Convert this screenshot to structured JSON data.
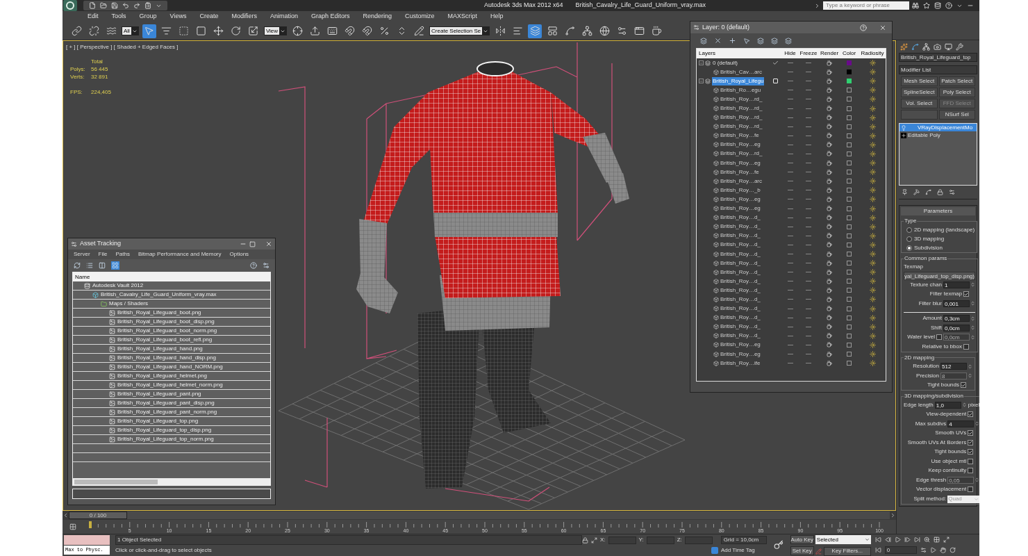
{
  "title_bar": {
    "app": "Autodesk 3ds Max  2012 x64",
    "file": "British_Cavalry_Life_Guard_Uniform_vray.max",
    "search": {
      "placeholder": "Type a keyword or phrase"
    }
  },
  "menu": [
    "Edit",
    "Tools",
    "Group",
    "Views",
    "Create",
    "Modifiers",
    "Animation",
    "Graph Editors",
    "Rendering",
    "Customize",
    "MAXScript",
    "Help"
  ],
  "toolbar": [
    {
      "kind": "link",
      "selected": false
    },
    {
      "kind": "unlink",
      "selected": false
    },
    {
      "kind": "bind",
      "selected": false
    },
    {
      "kind": "dropdown",
      "value": "All"
    },
    {
      "kind": "select",
      "selected": true
    },
    {
      "kind": "select-name",
      "selected": false
    },
    {
      "kind": "region",
      "selected": false
    },
    {
      "kind": "crossing",
      "selected": false
    },
    {
      "kind": "move",
      "selected": false
    },
    {
      "kind": "rotate",
      "selected": false
    },
    {
      "kind": "scale",
      "selected": false
    },
    {
      "kind": "dropdown",
      "value": "View"
    },
    {
      "kind": "pivot",
      "selected": false
    },
    {
      "kind": "manipulate",
      "selected": false
    },
    {
      "kind": "shortcut",
      "selected": false
    },
    {
      "kind": "snap",
      "selected": false
    },
    {
      "kind": "angle-snap",
      "selected": false
    },
    {
      "kind": "percent-snap",
      "selected": false
    },
    {
      "kind": "spinner-snap",
      "selected": false
    },
    {
      "kind": "named-sel",
      "selected": false
    },
    {
      "kind": "dropdown",
      "value": "Create Selection Se"
    },
    {
      "kind": "mirror",
      "selected": false
    },
    {
      "kind": "align",
      "selected": false
    },
    {
      "kind": "layers",
      "selected": true
    },
    {
      "kind": "ribbon",
      "selected": false
    },
    {
      "kind": "curve",
      "selected": false
    },
    {
      "kind": "schematic",
      "selected": false
    },
    {
      "kind": "material",
      "selected": false
    },
    {
      "kind": "render-setup",
      "selected": false
    },
    {
      "kind": "frame-window",
      "selected": false
    },
    {
      "kind": "render",
      "selected": false
    }
  ],
  "viewport": {
    "label": "[ + ] [ Perspective ] [ Shaded + Edged Faces ]",
    "stats_header": "Total",
    "stats": [
      {
        "label": "Polys:",
        "value": "56 445"
      },
      {
        "label": "Verts:",
        "value": "32 891"
      }
    ],
    "performance": [
      {
        "label": "FPS:",
        "value": "224,405"
      }
    ]
  },
  "asset_tracking": {
    "title": "Asset Tracking",
    "menu": [
      "Server",
      "File",
      "Paths",
      "Bitmap Performance and Memory",
      "Options"
    ],
    "column": "Name",
    "tree": [
      {
        "name": "Autodesk Vault 2012",
        "kind": "vault",
        "children": [
          {
            "name": "British_Cavalry_Life_Guard_Uniform_vray.max",
            "kind": "scene",
            "children": [
              {
                "name": "Maps / Shaders",
                "kind": "folder",
                "children": [
                  {
                    "name": "British_Royal_Lifeguard_boot.png",
                    "kind": "map"
                  },
                  {
                    "name": "British_Royal_Lifeguard_boot_disp.png",
                    "kind": "map"
                  },
                  {
                    "name": "British_Royal_Lifeguard_boot_norm.png",
                    "kind": "map"
                  },
                  {
                    "name": "British_Royal_Lifeguard_boot_refl.png",
                    "kind": "map"
                  },
                  {
                    "name": "British_Royal_Lifeguard_hand.png",
                    "kind": "map"
                  },
                  {
                    "name": "British_Royal_Lifeguard_hand_disp.png",
                    "kind": "map"
                  },
                  {
                    "name": "British_Royal_Lifeguard_hand_NORM.png",
                    "kind": "map"
                  },
                  {
                    "name": "British_Royal_Lifeguard_helmet.png",
                    "kind": "map"
                  },
                  {
                    "name": "British_Royal_Lifeguard_helmet_norm.png",
                    "kind": "map"
                  },
                  {
                    "name": "British_Royal_Lifeguard_pant.png",
                    "kind": "map"
                  },
                  {
                    "name": "British_Royal_Lifeguard_pant_disp.png",
                    "kind": "map"
                  },
                  {
                    "name": "British_Royal_Lifeguard_pant_norm.png",
                    "kind": "map"
                  },
                  {
                    "name": "British_Royal_Lifeguard_top.png",
                    "kind": "map"
                  },
                  {
                    "name": "British_Royal_Lifeguard_top_disp.png",
                    "kind": "map"
                  },
                  {
                    "name": "British_Royal_Lifeguard_top_norm.png",
                    "kind": "map"
                  }
                ]
              }
            ]
          }
        ]
      }
    ]
  },
  "layer_manager": {
    "title": "Layer: 0 (default)",
    "columns": [
      "Layers",
      "Hide",
      "Freeze",
      "Render",
      "Color",
      "Radiosity"
    ],
    "layers": [
      {
        "name": "0 (default)",
        "current": true,
        "selected": false,
        "expanded": true,
        "color": "#6a0a8c",
        "objects": [
          {
            "name": "British_Cav…arc",
            "color": "#000000"
          }
        ]
      },
      {
        "name": "British_Royal_Lifegu",
        "current": false,
        "selected": true,
        "expanded": true,
        "color": "#30d070",
        "objects": [
          {
            "name": "British_Ro…egu"
          },
          {
            "name": "British_Roy…rd_"
          },
          {
            "name": "British_Roy…rd_"
          },
          {
            "name": "British_Roy…rd_"
          },
          {
            "name": "British_Roy…rd_"
          },
          {
            "name": "British_Roy…fe"
          },
          {
            "name": "British_Roy…eg"
          },
          {
            "name": "British_Roy…rd_"
          },
          {
            "name": "British_Roy…eg"
          },
          {
            "name": "British_Roy…fe"
          },
          {
            "name": "British_Roy…arc"
          },
          {
            "name": "British_Roy…_b"
          },
          {
            "name": "British_Roy…eg"
          },
          {
            "name": "British_Roy…eg"
          },
          {
            "name": "British_Roy…d_"
          },
          {
            "name": "British_Roy…d_"
          },
          {
            "name": "British_Roy…d_"
          },
          {
            "name": "British_Roy…d_"
          },
          {
            "name": "British_Roy…d_"
          },
          {
            "name": "British_Roy…d_"
          },
          {
            "name": "British_Roy…d_"
          },
          {
            "name": "British_Roy…d_"
          },
          {
            "name": "British_Roy…d_"
          },
          {
            "name": "British_Roy…d_"
          },
          {
            "name": "British_Roy…d_"
          },
          {
            "name": "British_Roy…d_"
          },
          {
            "name": "British_Roy…d_"
          },
          {
            "name": "British_Roy…d_"
          },
          {
            "name": "British_Roy…eg"
          },
          {
            "name": "British_Roy…eg"
          },
          {
            "name": "British_Roy…ife"
          }
        ]
      }
    ]
  },
  "command_panel": {
    "object_name": "British_Royal_Lifeguard_top",
    "modifier_list": "Modifier List",
    "buttons": [
      [
        {
          "kind": "button",
          "label": "Mesh Select",
          "disabled": false
        },
        {
          "kind": "button",
          "label": "Patch Select",
          "disabled": false
        }
      ],
      [
        {
          "kind": "button",
          "label": "SplineSelect",
          "disabled": false
        },
        {
          "kind": "button",
          "label": "Poly Select",
          "disabled": false
        }
      ],
      [
        {
          "kind": "button",
          "label": "Vol. Select",
          "disabled": false
        },
        {
          "kind": "button",
          "label": "FFD Select",
          "disabled": true
        }
      ],
      [
        {
          "kind": "blank"
        },
        {
          "kind": "button",
          "label": "NSurf Sel",
          "disabled": false
        }
      ]
    ],
    "stack": [
      {
        "name": "VRayDisplacementMo",
        "kind": "modifier",
        "selected": true
      },
      {
        "name": "Editable Poly",
        "kind": "base",
        "selected": false
      }
    ],
    "rollout": "Parameters",
    "type_group": {
      "title": "Type",
      "options": [
        {
          "label": "2D mapping (landscape)",
          "selected": false
        },
        {
          "label": "3D mapping",
          "selected": false
        },
        {
          "label": "Subdivision",
          "selected": true
        }
      ]
    },
    "groups": [
      {
        "title": "Common params",
        "rows": [
          {
            "kind": "label",
            "label": "Texmap"
          },
          {
            "kind": "map",
            "value": "yal_Lifeguard_top_disp.png)"
          },
          {
            "kind": "spinner",
            "label": "Texture chan",
            "value": "1",
            "disabled": false
          },
          {
            "kind": "check",
            "label": "Filter texmap",
            "checked": true
          },
          {
            "kind": "spinner",
            "label": "Filter blur",
            "value": "0,001",
            "disabled": false
          },
          {
            "kind": "rule"
          },
          {
            "kind": "spinner",
            "label": "Amount",
            "value": "0,3cm",
            "disabled": false
          },
          {
            "kind": "spinner",
            "label": "Shift",
            "value": "0,0cm",
            "disabled": false
          },
          {
            "kind": "check_spinner",
            "label": "Water level",
            "checked": false,
            "value": "0,0cm",
            "disabled": true
          },
          {
            "kind": "check",
            "label": "Relative to bbox",
            "checked": false
          }
        ]
      },
      {
        "title": "2D mapping",
        "rows": [
          {
            "kind": "spinner",
            "label": "Resolution",
            "value": "512",
            "disabled": false
          },
          {
            "kind": "spinner",
            "label": "Precision",
            "value": "8",
            "disabled": true
          },
          {
            "kind": "check",
            "label": "Tight bounds",
            "checked": true
          }
        ]
      },
      {
        "title": "3D mapping/subdivision",
        "rows": [
          {
            "kind": "spinner",
            "label": "Edge length",
            "value": "1,0",
            "unit": "pixel",
            "disabled": false
          },
          {
            "kind": "check",
            "label": "View-dependent",
            "checked": true
          },
          {
            "kind": "spinner",
            "label": "Max subdivs",
            "value": "4",
            "disabled": false
          },
          {
            "kind": "check",
            "label": "Smooth UVs",
            "checked": true
          },
          {
            "kind": "check",
            "label": "Smooth UVs At Borders",
            "checked": true
          },
          {
            "kind": "check",
            "label": "Tight bounds",
            "checked": true
          },
          {
            "kind": "check",
            "label": "Use object mtl",
            "checked": false
          },
          {
            "kind": "check",
            "label": "Keep continuity",
            "checked": false
          },
          {
            "kind": "spinner",
            "label": "Edge thresh",
            "value": "0,05",
            "disabled": true
          },
          {
            "kind": "check",
            "label": "Vector displacement",
            "checked": false
          },
          {
            "kind": "dropdown",
            "label": "Split method:",
            "value": "Quad"
          }
        ]
      }
    ]
  },
  "time_slider": {
    "label": "0 / 100",
    "level": 0
  },
  "ruler_labels": [
    "5",
    "10",
    "15",
    "20",
    "25",
    "30",
    "35",
    "40",
    "45",
    "50",
    "55",
    "60",
    "65",
    "70",
    "75",
    "80",
    "85",
    "90",
    "95",
    "100"
  ],
  "status": {
    "listener": "Max to Physc.",
    "selection": "1 Object Selected",
    "prompt": "Click or click-and-drag to select objects",
    "axes": [
      "X:",
      "Y:",
      "Z:"
    ],
    "grid": "Grid = 10,0cm",
    "time_tag": "Add Time Tag",
    "auto_key": "Auto Key",
    "key_mode": "Selected",
    "set_key": "Set Key",
    "key_filters": "Key Filters...",
    "frame": "0"
  }
}
